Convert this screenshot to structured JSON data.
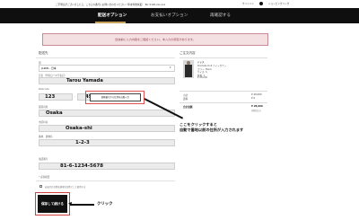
{
  "topbar": {
    "message": "ご不明点がございましたら、こちらの番号にお問い合わせください（年末年始休業）  Tel: 0120-xxx-xxx",
    "signin": "サインイン",
    "cart": "ショッピングバッグ"
  },
  "nav": {
    "tabs": [
      {
        "label": "配送オプション",
        "active": true
      },
      {
        "label": "お支払いオプション",
        "active": false
      },
      {
        "label": "再確認する",
        "active": false
      }
    ]
  },
  "alert": {
    "text": "送信前に入力内容をご確認ください。未入力の項目があります。"
  },
  "form": {
    "section_title": "配送先",
    "country_label": "国",
    "country_value": "JAPAN - 日本",
    "name_label": "氏名（半角ローマ字表記）",
    "name_value": "Tarou Yamada",
    "postal_label": "Postcode",
    "postal1": "123",
    "postal2": "456",
    "lookup_button": "郵便番号から住所を自動入力",
    "prefecture_label": "都道府県",
    "prefecture_value": "Osaka",
    "city_label": "市区町村",
    "city_value": "Osaka-shi",
    "address_label": "番地、建物名",
    "address_value": "1-2-3",
    "phone_label": "電話番号",
    "phone_value": "81-6-1234-5678",
    "required_note": "* 必須項目",
    "checkbox_label": "お届け先住所を請求先住所として使用する",
    "submit_label": "保存して続ける"
  },
  "annotations": {
    "lookup_note_line1": "ここをクリックすると",
    "lookup_note_line2": "自動で番地以前の住所が入力されます",
    "submit_note": "クリック"
  },
  "order": {
    "title": "ご注文内容",
    "item_name": "ドレス",
    "item_lines": [
      "Pointelle Knit ナイトガウン",
      "カラー: Black",
      "サイズ: S",
      "数量: 1",
      "¥ 28,000"
    ],
    "subtotal_label": "小計",
    "subtotal_value": "¥ 28,000",
    "shipping_label": "送料",
    "shipping_value": "¥ 0",
    "total_label": "合計金額",
    "total_value": "¥ 28,000",
    "tax_note": "消費税込み"
  },
  "colors": {
    "nav_bg": "#0f0f0f",
    "alert_bg": "#f4dfe2",
    "accent": "#c8a25a",
    "highlight_red": "#e05050"
  }
}
